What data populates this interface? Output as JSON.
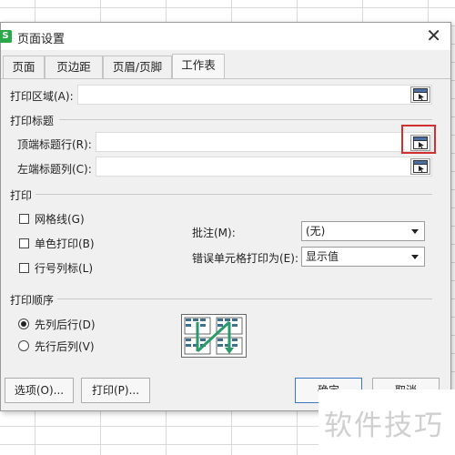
{
  "window": {
    "title": "页面设置",
    "app_icon_letter": "S",
    "close_label": "✕"
  },
  "tabs": [
    {
      "label": "页面"
    },
    {
      "label": "页边距"
    },
    {
      "label": "页眉/页脚"
    },
    {
      "label": "工作表",
      "active": true
    }
  ],
  "print_area": {
    "label": "打印区域(A):",
    "value": ""
  },
  "print_titles": {
    "section": "打印标题",
    "rows_label": "顶端标题行(R):",
    "rows_value": "",
    "cols_label": "左端标题列(C):",
    "cols_value": ""
  },
  "print": {
    "section": "打印",
    "gridlines": {
      "label": "网格线(G)",
      "checked": false
    },
    "mono": {
      "label": "单色打印(B)",
      "checked": false
    },
    "headings": {
      "label": "行号列标(L)",
      "checked": false
    },
    "comments_label": "批注(M):",
    "comments_value": "(无)",
    "errors_label": "错误单元格打印为(E):",
    "errors_value": "显示值"
  },
  "order": {
    "section": "打印顺序",
    "down_then_over": {
      "label": "先列后行(D)",
      "selected": true
    },
    "over_then_down": {
      "label": "先行后列(V)",
      "selected": false
    }
  },
  "buttons": {
    "options": "选项(O)...",
    "print": "打印(P)...",
    "ok": "确定",
    "cancel": "取消"
  },
  "watermark": "软件技巧",
  "colors": {
    "highlight": "#d23030",
    "app_icon": "#2aa84a",
    "primary_border": "#3a76c4"
  }
}
